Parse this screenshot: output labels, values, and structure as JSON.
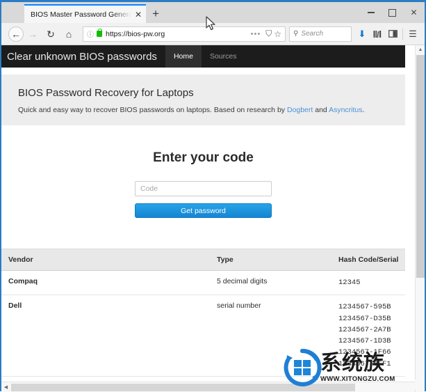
{
  "browser": {
    "tab": {
      "title": "BIOS Master Password Generator fo",
      "close_label": "✕"
    },
    "new_tab_label": "+",
    "window_controls": {
      "minimize": "–",
      "maximize": "□",
      "close": "✕"
    },
    "nav": {
      "back": "←",
      "forward": "→",
      "reload": "↻",
      "home": "⌂"
    },
    "url_bar": {
      "info_icon": "ⓘ",
      "url": "https://bios-pw.org",
      "page_actions": "•••",
      "shield_icon": "⛉",
      "bookmark_icon": "☆",
      "lock_color": "#12bc00"
    },
    "search": {
      "icon": "⚲",
      "placeholder": "Search"
    },
    "toolbar_right": {
      "download": "⬇",
      "library": "‖‖",
      "sidebar": "◫",
      "menu": "☰",
      "download_color": "#0a78d4"
    }
  },
  "site": {
    "navbar": {
      "brand": "Clear unknown BIOS passwords",
      "links": [
        {
          "label": "Home",
          "active": true
        },
        {
          "label": "Sources",
          "active": false
        }
      ]
    },
    "jumbotron": {
      "title": "BIOS Password Recovery for Laptops",
      "subtitle_before": "Quick and easy way to recover BIOS passwords on laptops. Based on research by ",
      "link1": "Dogbert",
      "subtitle_middle": " and ",
      "link2": "Asyncritus",
      "subtitle_after": ".",
      "link_color": "#4a90d9"
    },
    "form": {
      "title": "Enter your code",
      "input_value": "",
      "input_placeholder": "Code",
      "submit_label": "Get password",
      "submit_color": "#1585d3"
    },
    "table": {
      "headers": [
        "Vendor",
        "Type",
        "Hash Code/Serial"
      ],
      "rows": [
        {
          "vendor": "Compaq",
          "type": "5 decimal digits",
          "hash": [
            "12345"
          ]
        },
        {
          "vendor": "Dell",
          "type": "serial number",
          "hash": [
            "1234567-595B",
            "1234567-D35B",
            "1234567-2A7B",
            "1234567-1D3B",
            "1234567-1F66",
            "1234567-6FF1"
          ]
        }
      ]
    }
  },
  "scrollbars": {
    "vertical_up": "▲",
    "horizontal_left": "◀"
  },
  "watermark": {
    "chinese": "系统族",
    "url": "WWW.XITONGZU.COM"
  }
}
